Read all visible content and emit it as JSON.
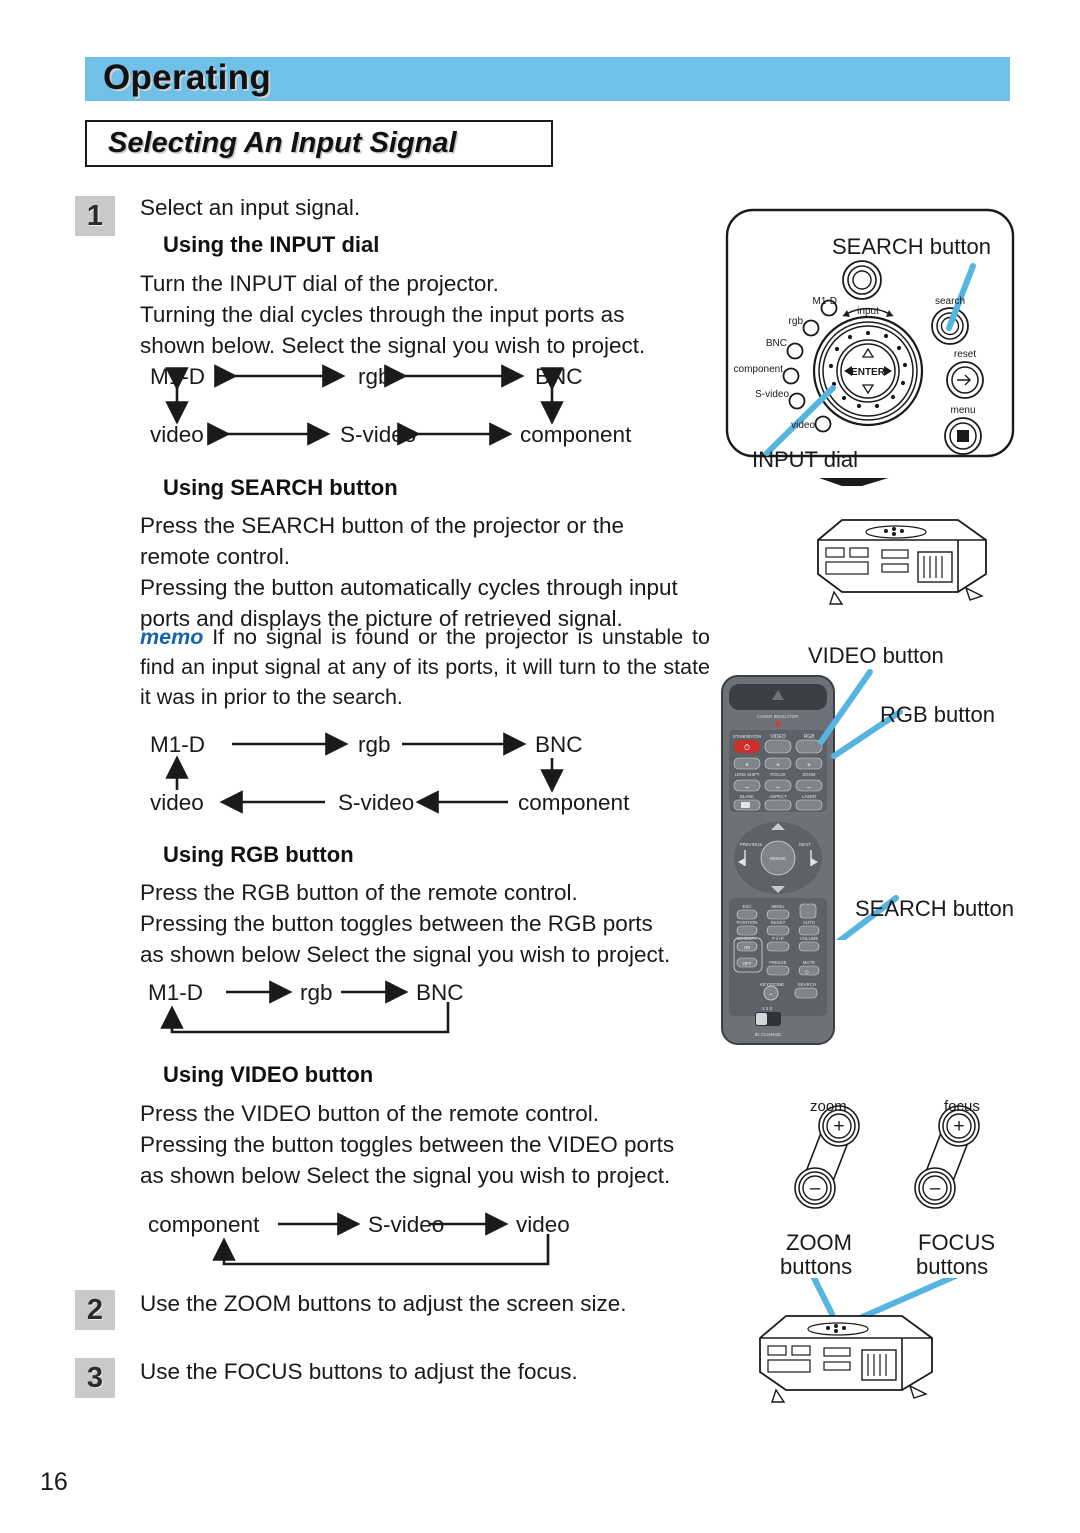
{
  "header": {
    "chapter": "Operating",
    "section": "Selecting An Input Signal"
  },
  "steps": [
    {
      "num": "1",
      "text": "Select an input signal."
    },
    {
      "num": "2",
      "text": "Use the ZOOM buttons to adjust the screen size."
    },
    {
      "num": "3",
      "text": "Use the FOCUS buttons to adjust the focus."
    }
  ],
  "subsections": {
    "input_dial": {
      "heading": "Using the INPUT dial",
      "body": "Turn the INPUT dial of the projector.\nTurning the dial cycles through the input ports as\nshown below. Select the signal you wish to project."
    },
    "search": {
      "heading": "Using SEARCH button",
      "body": "Press the SEARCH button of the projector or the\nremote control.\nPressing the button automatically cycles through input\nports and displays the picture of retrieved signal.",
      "memo_keyword": "memo",
      "memo_body": "If no signal is found or the projector is unstable to find an input signal at any of its ports, it will turn to the state it was in prior to the search."
    },
    "rgb": {
      "heading": "Using RGB button",
      "body": "Press the RGB button of the remote control.\nPressing the button toggles between the RGB ports\nas shown below Select the signal you wish to project."
    },
    "video": {
      "heading": "Using VIDEO button",
      "body": "Press the VIDEO button of the remote control.\nPressing the button toggles between the VIDEO ports\nas shown below Select the signal you wish to project."
    }
  },
  "diagrams": {
    "dial": {
      "top_row": [
        "M1-D",
        "rgb",
        "BNC"
      ],
      "bottom_row": [
        "video",
        "S-video",
        "component"
      ],
      "direction": "bidirectional"
    },
    "search": {
      "top_row": [
        "M1-D",
        "rgb",
        "BNC"
      ],
      "bottom_row": [
        "video",
        "S-video",
        "component"
      ],
      "direction": "one-way-cycle"
    },
    "rgb": {
      "nodes": [
        "M1-D",
        "rgb",
        "BNC"
      ],
      "direction": "one-way-loop"
    },
    "video": {
      "nodes": [
        "component",
        "S-video",
        "video"
      ],
      "direction": "one-way-loop"
    }
  },
  "illustrations": {
    "control_panel": {
      "callouts": {
        "search": "SEARCH button",
        "input_dial": "INPUT dial"
      },
      "led_labels": [
        "M1-D",
        "rgb",
        "BNC",
        "component",
        "S-video",
        "video"
      ],
      "dial_label": "input",
      "enter_label": "ENTER",
      "buttons": [
        "search",
        "reset",
        "menu"
      ]
    },
    "remote": {
      "callouts": {
        "video": "VIDEO button",
        "rgb": "RGB button",
        "search": "SEARCH button"
      },
      "indicator": "LASER INDICATOR",
      "keys": [
        "STANDBY/ON",
        "VIDEO",
        "RGB",
        "LENS SHIFT",
        "FOCUS",
        "ZOOM",
        "BLANK",
        "ASPECT",
        "LASER",
        "PREVIOUS",
        "NEXT",
        "MOUSE",
        "ESC",
        "MENU",
        "POSITION",
        "RESET",
        "AUTO",
        "MAGNIFY",
        "ON",
        "OFF",
        "PinP",
        "VOLUME",
        "FREEZE",
        "MUTE",
        "KEYSTONE",
        "SEARCH"
      ],
      "id_switch_positions": "1 2 3",
      "id_switch_label": "ID CHANGE"
    },
    "lens_buttons": {
      "zoom_small_label": "zoom",
      "focus_small_label": "focus",
      "zoom_caption_line1": "ZOOM",
      "zoom_caption_line2": "buttons",
      "focus_caption_line1": "FOCUS",
      "focus_caption_line2": "buttons",
      "plus": "+",
      "minus": "–"
    }
  },
  "colors": {
    "header_band": "#6fc1e8",
    "callout_line": "#56b4e0",
    "memo_keyword": "#1664ab",
    "step_chip": "#c9c9c9",
    "remote_body": "#6d7278"
  },
  "page_number": "16"
}
